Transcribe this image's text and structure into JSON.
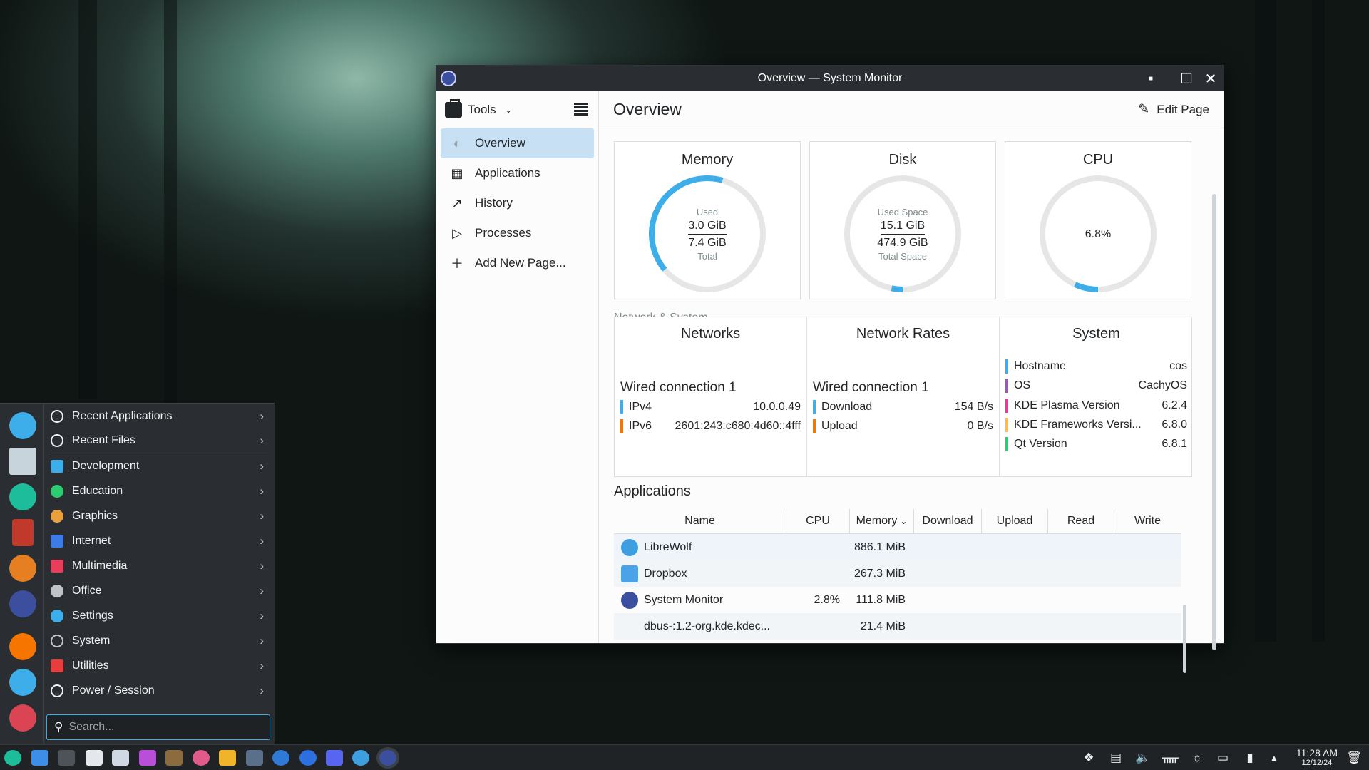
{
  "window": {
    "title": "Overview — System Monitor",
    "tools_label": "Tools",
    "page_title": "Overview",
    "edit_page_label": "Edit Page"
  },
  "sidebar": {
    "items": [
      {
        "label": "Overview",
        "icon": "overview-icon"
      },
      {
        "label": "Applications",
        "icon": "grid-icon"
      },
      {
        "label": "History",
        "icon": "chart-icon"
      },
      {
        "label": "Processes",
        "icon": "play-icon"
      },
      {
        "label": "Add New Page...",
        "icon": "plus-icon"
      }
    ]
  },
  "overview": {
    "memory": {
      "title": "Memory",
      "used_label": "Used",
      "used": "3.0 GiB",
      "total": "7.4 GiB",
      "total_label": "Total",
      "fraction": 0.405,
      "color": "#3daee9"
    },
    "disk": {
      "title": "Disk",
      "used_label": "Used Space",
      "used": "15.1 GiB",
      "total": "474.9 GiB",
      "total_label": "Total Space",
      "fraction": 0.032,
      "color": "#3daee9"
    },
    "cpu": {
      "title": "CPU",
      "value": "6.8%",
      "fraction": 0.068,
      "color": "#3daee9"
    },
    "section_label": "Network & System",
    "networks": {
      "title": "Networks",
      "connection": "Wired connection 1",
      "rows": [
        {
          "label": "IPv4",
          "value": "10.0.0.49",
          "color": "#3daee9"
        },
        {
          "label": "IPv6",
          "value": "2601:243:c680:4d60::4fff",
          "color": "#f67400"
        }
      ]
    },
    "rates": {
      "title": "Network Rates",
      "connection": "Wired connection 1",
      "rows": [
        {
          "label": "Download",
          "value": "154 B/s",
          "color": "#3daee9"
        },
        {
          "label": "Upload",
          "value": "0 B/s",
          "color": "#f67400"
        }
      ]
    },
    "system": {
      "title": "System",
      "rows": [
        {
          "label": "Hostname",
          "value": "cos",
          "color": "#3daee9"
        },
        {
          "label": "OS",
          "value": "CachyOS",
          "color": "#9b59b6"
        },
        {
          "label": "KDE Plasma Version",
          "value": "6.2.4",
          "color": "#e93a9a"
        },
        {
          "label": "KDE Frameworks Versi...",
          "value": "6.8.0",
          "color": "#fdbc4b"
        },
        {
          "label": "Qt Version",
          "value": "6.8.1",
          "color": "#2ecc71"
        }
      ]
    },
    "applications": {
      "title": "Applications",
      "columns": [
        "Name",
        "CPU",
        "Memory",
        "Download",
        "Upload",
        "Read",
        "Write"
      ],
      "rows": [
        {
          "name": "LibreWolf",
          "cpu": "",
          "memory": "886.1 MiB",
          "icon": "librewolf-icon",
          "color": "#3d9ee0"
        },
        {
          "name": "Dropbox",
          "cpu": "",
          "memory": "267.3 MiB",
          "icon": "dropbox-icon",
          "color": "#4aa3e8"
        },
        {
          "name": "System Monitor",
          "cpu": "2.8%",
          "memory": "111.8 MiB",
          "icon": "system-monitor-icon",
          "color": "#3c4f9e"
        },
        {
          "name": "dbus-:1.2-org.kde.kdec...",
          "cpu": "",
          "memory": "21.4 MiB",
          "icon": "",
          "color": ""
        }
      ]
    }
  },
  "launcher": {
    "categories": [
      {
        "label": "Recent Applications",
        "icon": "clock-icon",
        "color": "#eff0f1"
      },
      {
        "label": "Recent Files",
        "icon": "clock-icon",
        "color": "#eff0f1"
      },
      {
        "label": "Development",
        "icon": "development-icon",
        "color": "#3daee9"
      },
      {
        "label": "Education",
        "icon": "education-icon",
        "color": "#2ecc71"
      },
      {
        "label": "Graphics",
        "icon": "graphics-icon",
        "color": "#e9a03d"
      },
      {
        "label": "Internet",
        "icon": "internet-icon",
        "color": "#3d7be9"
      },
      {
        "label": "Multimedia",
        "icon": "multimedia-icon",
        "color": "#e93d5a"
      },
      {
        "label": "Office",
        "icon": "office-icon",
        "color": "#bdc3c7"
      },
      {
        "label": "Settings",
        "icon": "settings-icon",
        "color": "#3daee9"
      },
      {
        "label": "System",
        "icon": "system-icon",
        "color": "#bdc3c7"
      },
      {
        "label": "Utilities",
        "icon": "utilities-icon",
        "color": "#e93d3d"
      },
      {
        "label": "Power / Session",
        "icon": "power-icon",
        "color": "#eff0f1"
      }
    ],
    "search_placeholder": "Search...",
    "favorites": [
      {
        "icon": "toggle-icon",
        "color": "#3daee9"
      },
      {
        "icon": "files-icon",
        "color": "#c8d4dc"
      },
      {
        "icon": "cachyos-icon",
        "color": "#1dbd9c"
      },
      {
        "icon": "red-app-icon",
        "color": "#c0392b"
      },
      {
        "icon": "gear-app-icon",
        "color": "#e67e22"
      },
      {
        "icon": "system-monitor-icon",
        "color": "#3c4f9e"
      },
      {
        "icon": "arrow-right-icon",
        "color": "#f67400"
      },
      {
        "icon": "refresh-icon",
        "color": "#3daee9"
      },
      {
        "icon": "power-icon",
        "color": "#da4453"
      }
    ]
  },
  "taskbar": {
    "time": "11:28 AM",
    "date": "12/12/24"
  }
}
